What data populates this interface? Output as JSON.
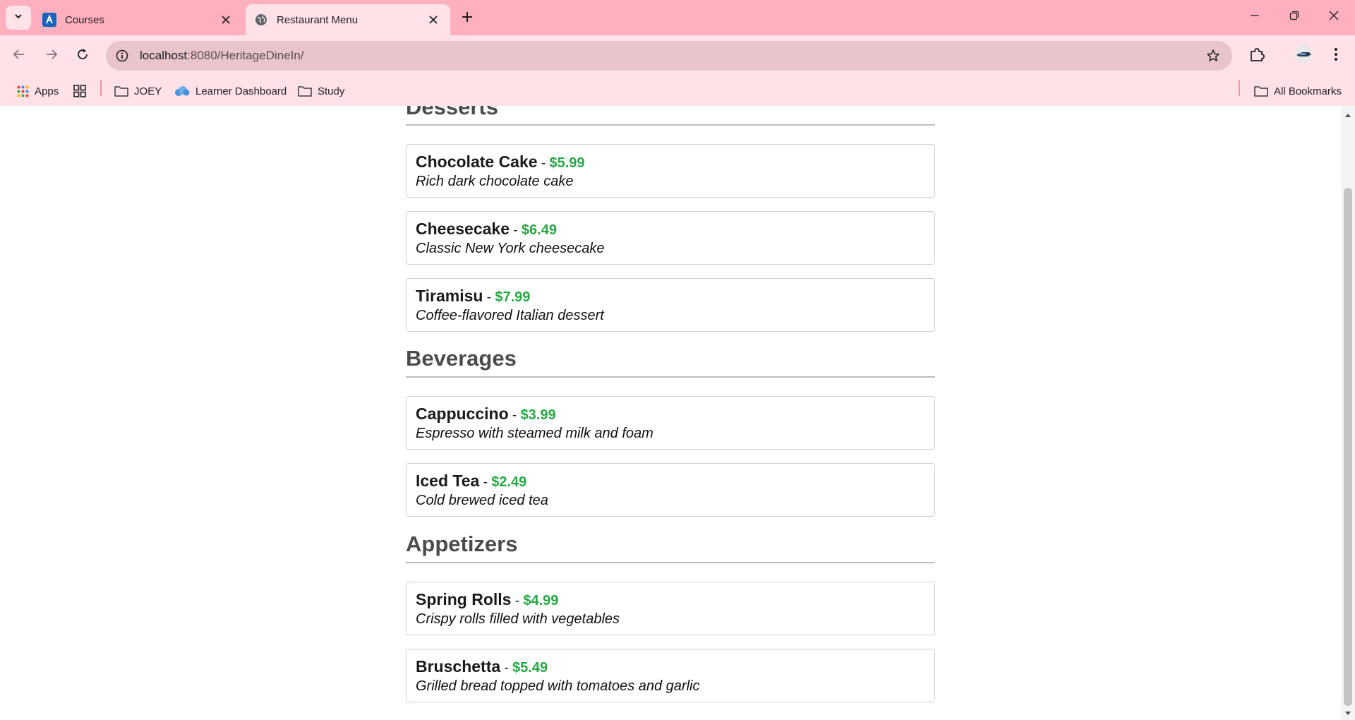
{
  "browser": {
    "tabs": [
      {
        "title": "Courses",
        "favicon": "coursera-logo-icon"
      },
      {
        "title": "Restaurant Menu",
        "favicon": "globe-icon"
      }
    ],
    "url_host": "localhost",
    "url_rest": ":8080/HeritageDineIn/",
    "accent_color": "#ffafbe",
    "bookmarks": {
      "apps": "Apps",
      "joey": "JOEY",
      "learner_dashboard": "Learner Dashboard",
      "study": "Study",
      "all_bookmarks": "All Bookmarks"
    }
  },
  "menu": {
    "price_color": "#28a745",
    "partial_section_title": "Desserts",
    "sections": [
      {
        "title": "Desserts",
        "items": [
          {
            "name": "Chocolate Cake",
            "price": "$5.99",
            "desc": "Rich dark chocolate cake"
          },
          {
            "name": "Cheesecake",
            "price": "$6.49",
            "desc": "Classic New York cheesecake"
          },
          {
            "name": "Tiramisu",
            "price": "$7.99",
            "desc": "Coffee-flavored Italian dessert"
          }
        ]
      },
      {
        "title": "Beverages",
        "items": [
          {
            "name": "Cappuccino",
            "price": "$3.99",
            "desc": "Espresso with steamed milk and foam"
          },
          {
            "name": "Iced Tea",
            "price": "$2.49",
            "desc": "Cold brewed iced tea"
          }
        ]
      },
      {
        "title": "Appetizers",
        "items": [
          {
            "name": "Spring Rolls",
            "price": "$4.99",
            "desc": "Crispy rolls filled with vegetables"
          },
          {
            "name": "Bruschetta",
            "price": "$5.49",
            "desc": "Grilled bread topped with tomatoes and garlic"
          }
        ]
      }
    ]
  },
  "separator": " - "
}
